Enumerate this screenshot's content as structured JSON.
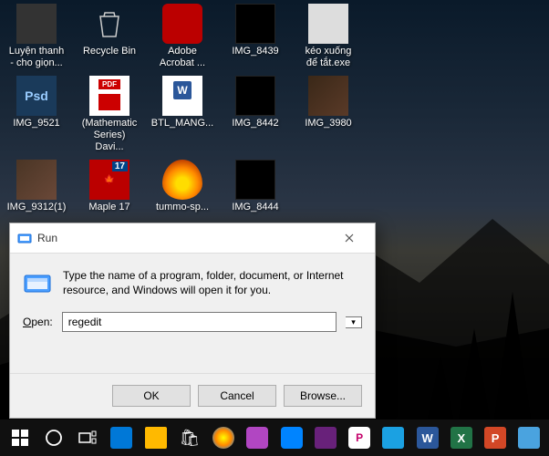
{
  "desktop": {
    "row1": [
      {
        "label": "Luyện thanh - cho giọn..."
      },
      {
        "label": "Recycle Bin"
      },
      {
        "label": "Adobe Acrobat ..."
      },
      {
        "label": "IMG_8439"
      },
      {
        "label": "kéo xuống để tắt.exe"
      }
    ],
    "row2": [
      {
        "label": "IMG_9521",
        "type": "psd"
      },
      {
        "label": "(Mathematic Series) Davi...",
        "type": "pdf"
      },
      {
        "label": "BTL_MANG...",
        "type": "word"
      },
      {
        "label": "IMG_8442",
        "type": "blackimg"
      },
      {
        "label": "IMG_3980",
        "type": "photoimg"
      }
    ],
    "row3": [
      {
        "label": "IMG_9312(1)",
        "type": "photo2"
      },
      {
        "label": "Maple 17",
        "type": "maple",
        "text": "🍁"
      },
      {
        "label": "tummo-sp...",
        "type": "fire"
      },
      {
        "label": "IMG_8444",
        "type": "blackimg"
      }
    ]
  },
  "run": {
    "title": "Run",
    "desc": "Type the name of a program, folder, document, or Internet resource, and Windows will open it for you.",
    "open_label": "Open:",
    "input_value": "regedit",
    "ok": "OK",
    "cancel": "Cancel",
    "browse": "Browse..."
  },
  "taskbar": {
    "items": [
      "start",
      "cortana",
      "taskview",
      "edge",
      "explorer",
      "store",
      "app1",
      "app2",
      "app3",
      "vs",
      "ps",
      "app4",
      "word",
      "excel",
      "ppt",
      "app5"
    ]
  }
}
